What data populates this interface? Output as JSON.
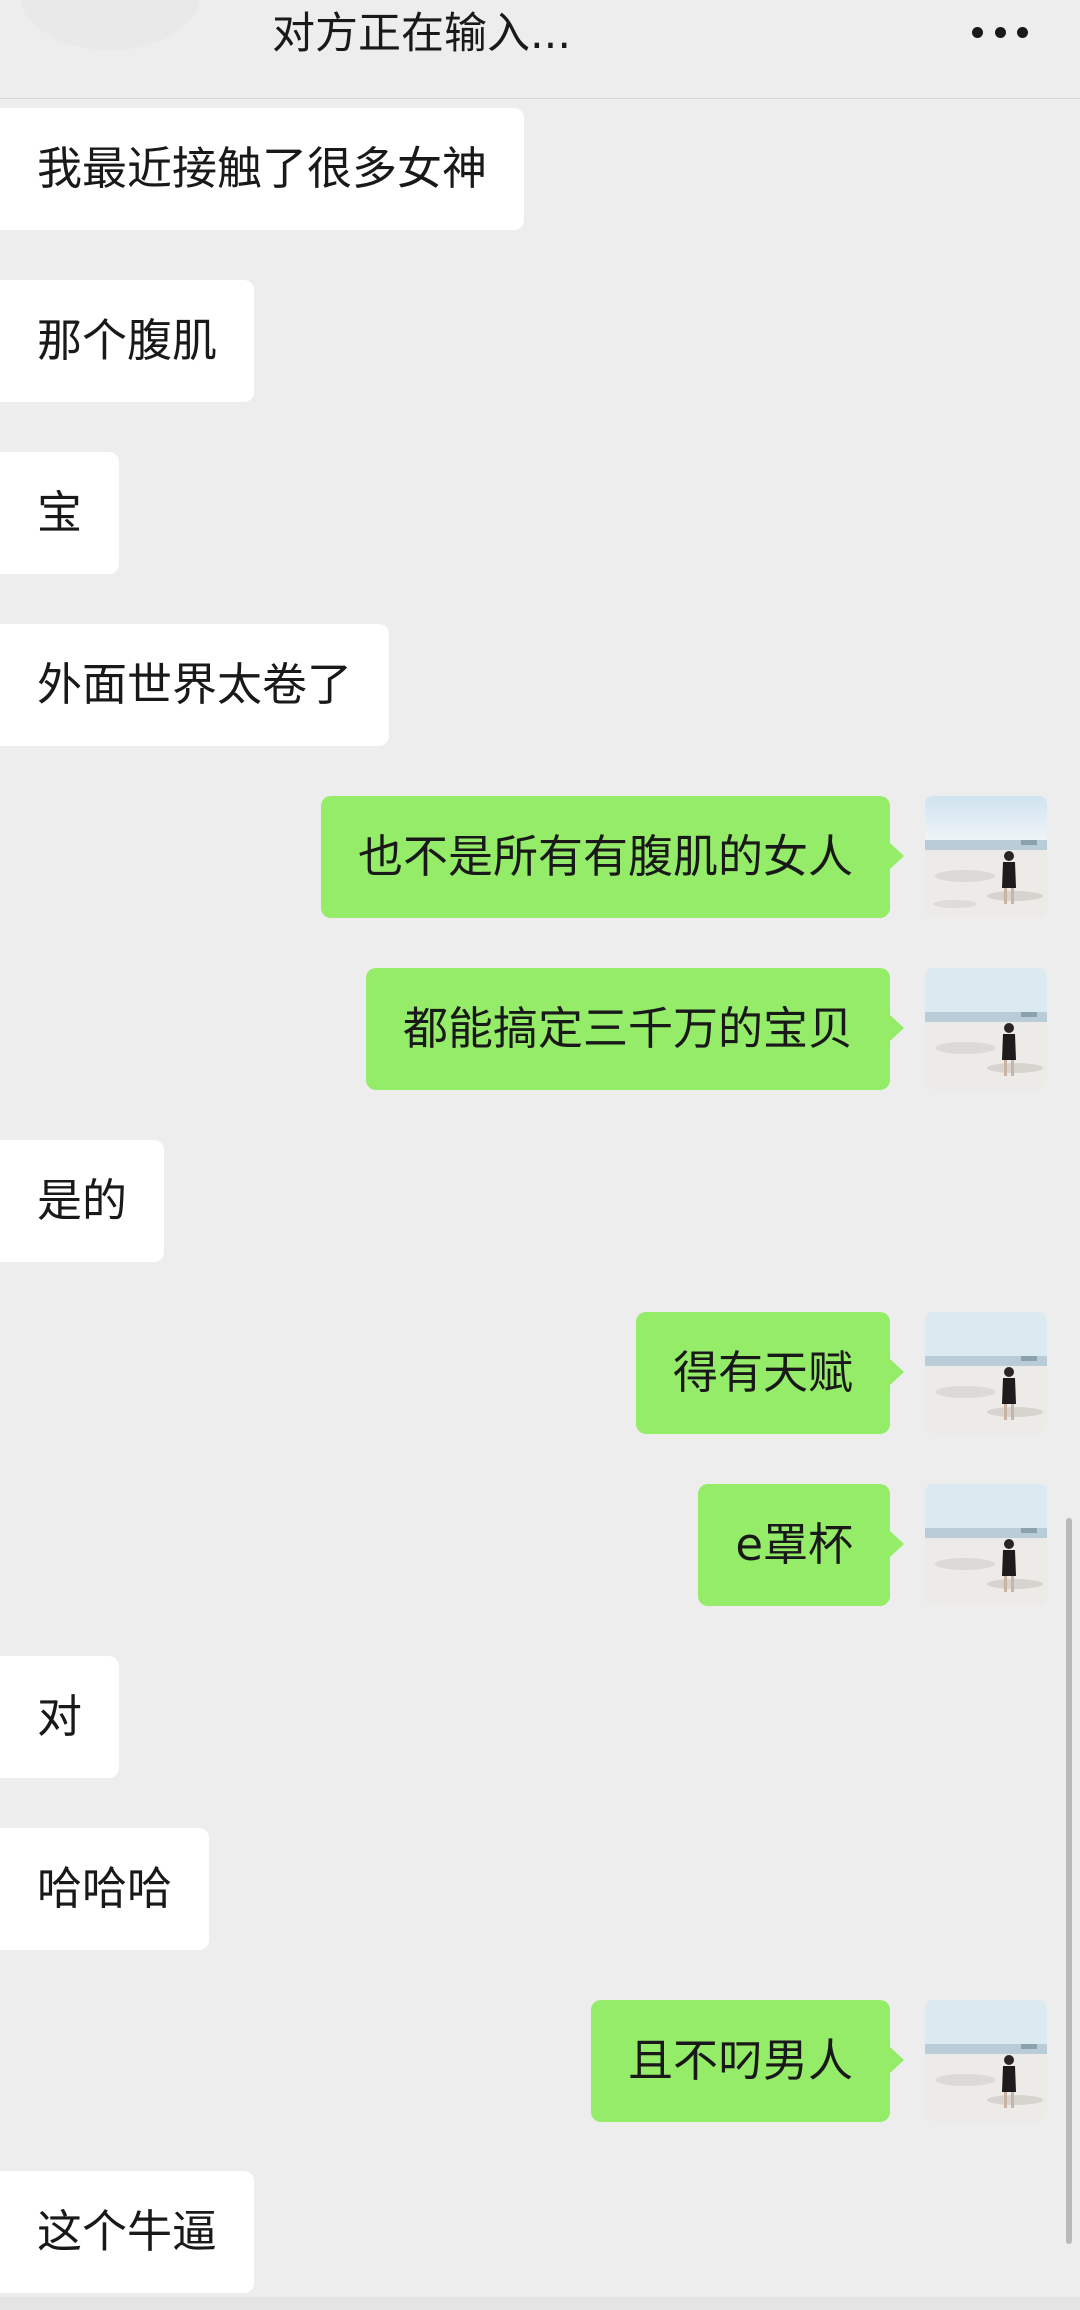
{
  "header": {
    "title": "对方正在输入...",
    "more_icon": "more-horizontal-icon"
  },
  "colors": {
    "background": "#ededed",
    "incoming_bubble": "#ffffff",
    "outgoing_bubble": "#95ec69",
    "text": "#191919"
  },
  "messages": [
    {
      "sender": "other",
      "text": "我最近接触了很多女神"
    },
    {
      "sender": "other",
      "text": "那个腹肌"
    },
    {
      "sender": "other",
      "text": "宝"
    },
    {
      "sender": "other",
      "text": "外面世界太卷了"
    },
    {
      "sender": "me",
      "text": "也不是所有有腹肌的女人"
    },
    {
      "sender": "me",
      "text": "都能搞定三千万的宝贝"
    },
    {
      "sender": "other",
      "text": "是的"
    },
    {
      "sender": "me",
      "text": "得有天赋"
    },
    {
      "sender": "me",
      "text": "e罩杯"
    },
    {
      "sender": "other",
      "text": "对"
    },
    {
      "sender": "other",
      "text": "哈哈哈"
    },
    {
      "sender": "me",
      "text": "且不叼男人"
    },
    {
      "sender": "other",
      "text": "这个牛逼"
    }
  ]
}
